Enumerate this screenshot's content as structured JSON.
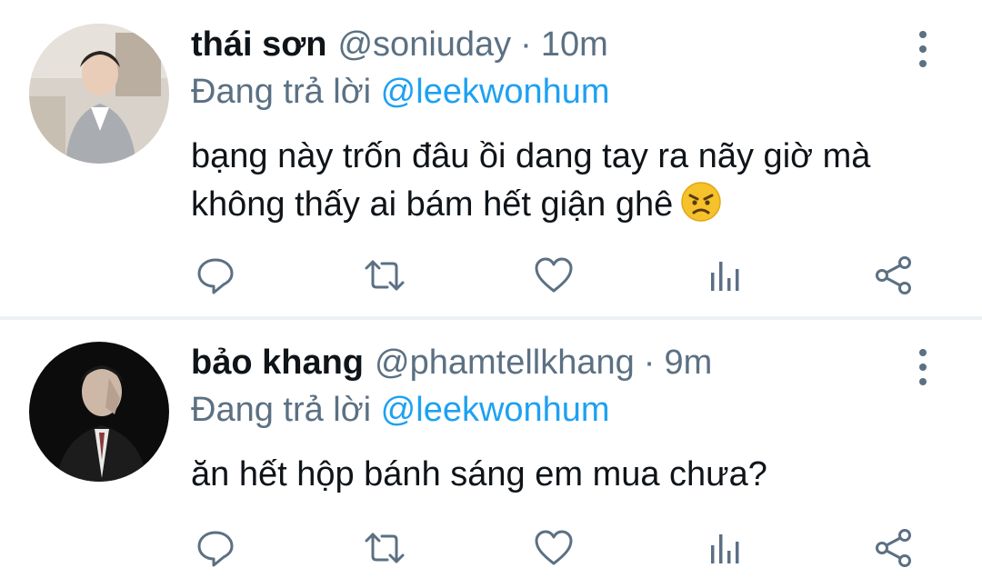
{
  "tweets": [
    {
      "display_name": "thái sơn",
      "handle": "@soniuday",
      "separator": "·",
      "time": "10m",
      "replying_prefix": "Đang trả lời",
      "replying_to": "@leekwonhum",
      "text": "bạng này trốn đâu ồi dang tay ra nãy giờ mà không thấy ai bám hết giận ghê",
      "emoji": "angry-face-emoji"
    },
    {
      "display_name": "bảo khang",
      "handle": "@phamtellkhang",
      "separator": "·",
      "time": "9m",
      "replying_prefix": "Đang trả lời",
      "replying_to": "@leekwonhum",
      "text": "ăn hết hộp bánh sáng em mua chưa?"
    }
  ],
  "icons": {
    "reply": "reply-icon",
    "retweet": "retweet-icon",
    "like": "heart-icon",
    "analytics": "analytics-icon",
    "share": "share-icon",
    "more": "more-vertical-icon"
  },
  "colors": {
    "primary_text": "#0f1419",
    "secondary_text": "#5b7083",
    "mention": "#1da1f2",
    "divider": "#eef1f3"
  }
}
